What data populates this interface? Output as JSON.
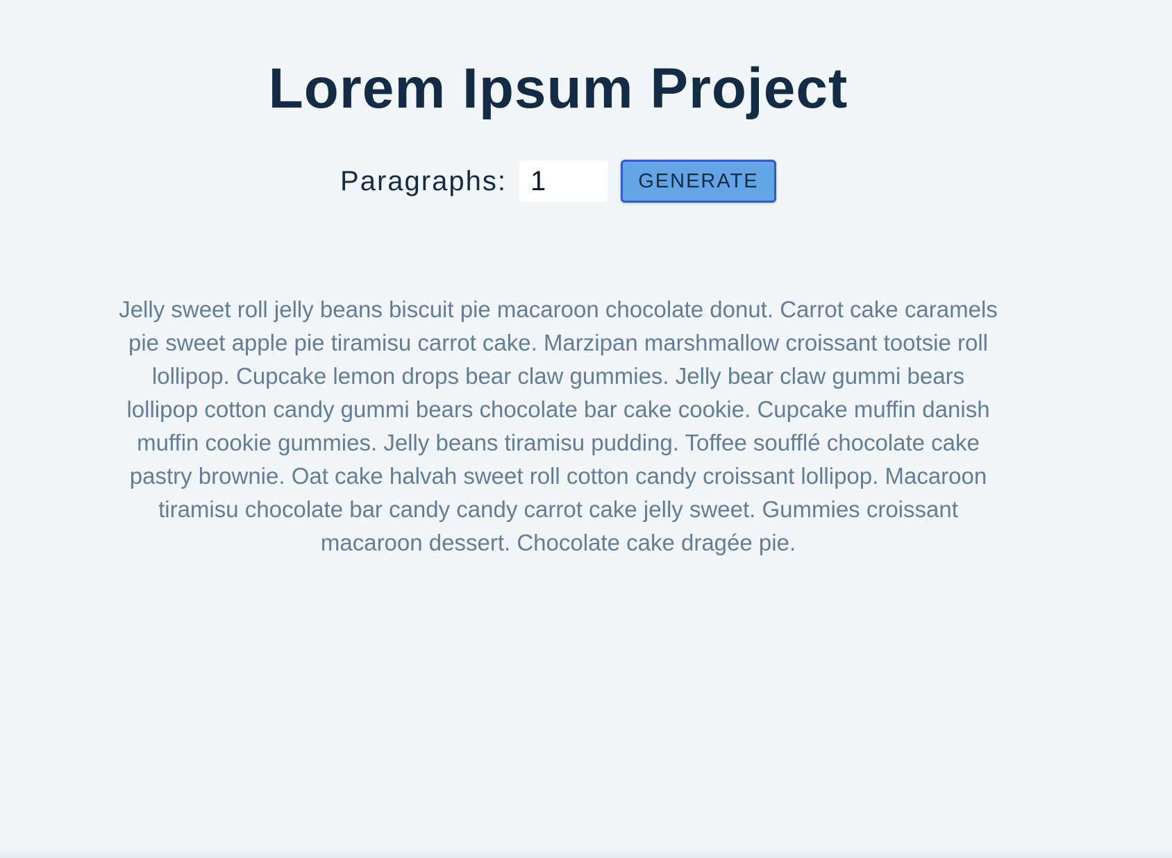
{
  "header": {
    "title": "Lorem Ipsum Project"
  },
  "form": {
    "label": "Paragraphs:",
    "amount_value": "1",
    "generate_label": "GENERATE"
  },
  "output": {
    "paragraphs": [
      "Jelly sweet roll jelly beans biscuit pie macaroon chocolate donut. Carrot cake caramels pie sweet apple pie tiramisu carrot cake. Marzipan marshmallow croissant tootsie roll lollipop. Cupcake lemon drops bear claw gummies. Jelly bear claw gummi bears lollipop cotton candy gummi bears chocolate bar cake cookie. Cupcake muffin danish muffin cookie gummies. Jelly beans tiramisu pudding. Toffee soufflé chocolate cake pastry brownie. Oat cake halvah sweet roll cotton candy croissant lollipop. Macaroon tiramisu chocolate bar candy candy carrot cake jelly sweet. Gummies croissant macaroon dessert. Chocolate cake dragée pie."
    ]
  },
  "colors": {
    "background": "#f1f5f8",
    "heading": "#142b45",
    "body_text": "#627d98",
    "button_fill": "#64a5e6",
    "button_border": "#2f5cc7"
  }
}
